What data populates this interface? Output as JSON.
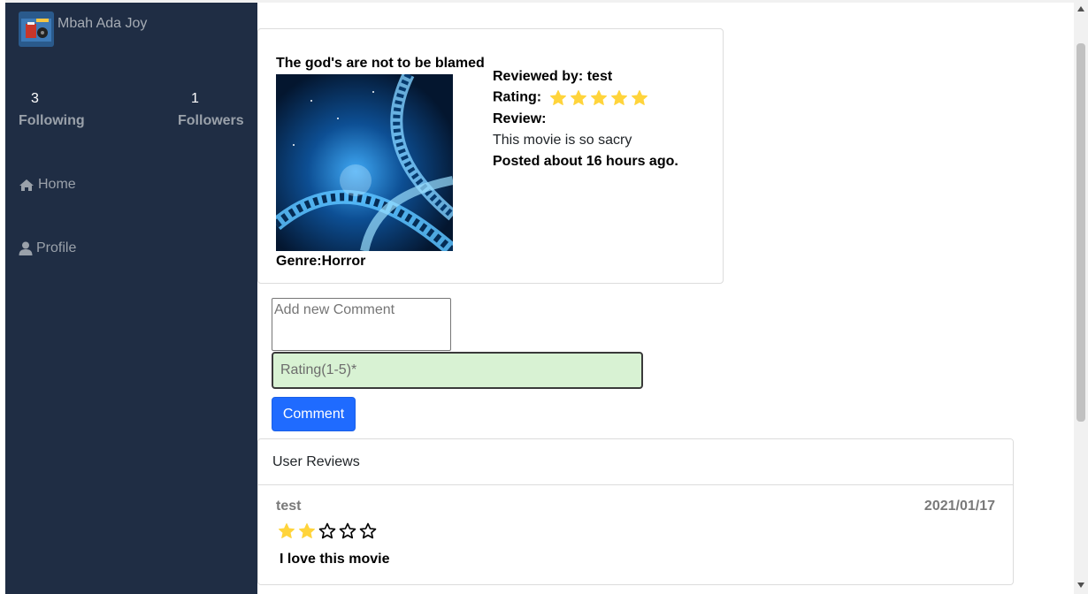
{
  "sidebar": {
    "user_name": "Mbah Ada Joy",
    "following": {
      "count": "3",
      "label": "Following"
    },
    "followers": {
      "count": "1",
      "label": "Followers"
    },
    "nav": [
      {
        "label": "Home",
        "icon": "home-icon"
      },
      {
        "label": "Profile",
        "icon": "user-icon"
      }
    ],
    "bg_color": "#1f2d44"
  },
  "review_card": {
    "title": "The god's are not to be blamed",
    "genre_label": "Genre:",
    "genre": "Horror",
    "reviewed_by_label": "Reviewed by:",
    "reviewed_by": "test",
    "rating_label": "Rating:",
    "rating": 5,
    "review_label": "Review:",
    "review_text": "This movie is so sacry",
    "posted": "Posted about 16 hours ago."
  },
  "comment_form": {
    "comment_placeholder": "Add new Comment",
    "rating_placeholder": "Rating(1-5)*",
    "submit_label": "Comment"
  },
  "user_reviews": {
    "header": "User Reviews",
    "items": [
      {
        "user": "test",
        "date": "2021/01/17",
        "rating": 2,
        "max_rating": 5,
        "text": "I love this movie"
      }
    ]
  },
  "colors": {
    "accent": "#1f6bff",
    "star": "#ffd43b",
    "rating_input_bg": "#d8f2d3"
  }
}
